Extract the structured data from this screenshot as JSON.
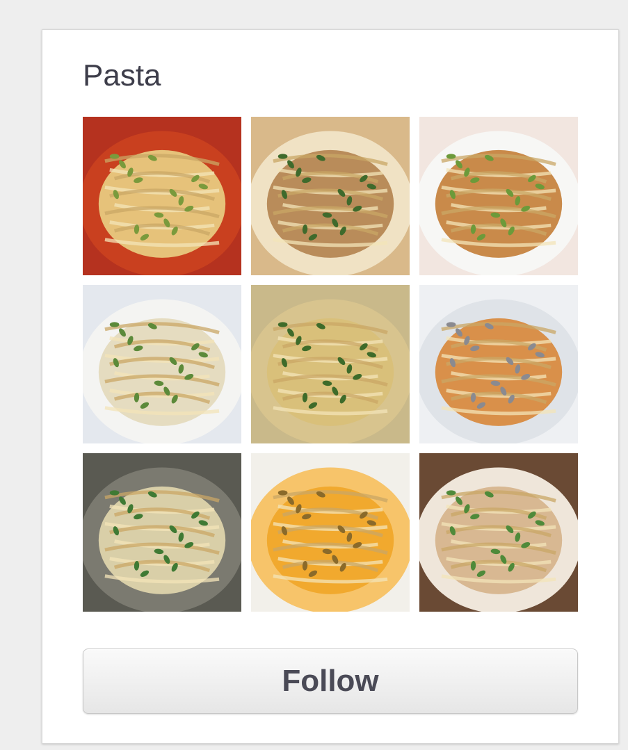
{
  "board": {
    "title": "Pasta",
    "follow_label": "Follow"
  },
  "thumbnails": [
    {
      "name": "thumb-pasta-1",
      "bg": "#b5321f",
      "plate": "#c9401f",
      "food": "#e6c27a",
      "accent": "#7a9a3c"
    },
    {
      "name": "thumb-pasta-2",
      "bg": "#d9b98a",
      "plate": "#f0e2c4",
      "food": "#b98c5a",
      "accent": "#3f6a2c"
    },
    {
      "name": "thumb-pasta-3",
      "bg": "#f2e6e0",
      "plate": "#f7f7f5",
      "food": "#c98a4a",
      "accent": "#6c9a3a"
    },
    {
      "name": "thumb-pasta-4",
      "bg": "#e4e8ee",
      "plate": "#f4f4f2",
      "food": "#e5dcc0",
      "accent": "#5c8a3a"
    },
    {
      "name": "thumb-pasta-5",
      "bg": "#c9b98a",
      "plate": "#d8c48e",
      "food": "#d9c07a",
      "accent": "#3e6b2a"
    },
    {
      "name": "thumb-pasta-6",
      "bg": "#eef0f3",
      "plate": "#dfe3e8",
      "food": "#d9904a",
      "accent": "#8a8a90"
    },
    {
      "name": "thumb-pasta-7",
      "bg": "#5a5a52",
      "plate": "#7b7a70",
      "food": "#d9cfa8",
      "accent": "#3f7a34"
    },
    {
      "name": "thumb-pasta-8",
      "bg": "#f2f0ea",
      "plate": "#f7c46a",
      "food": "#f1a92e",
      "accent": "#8a6a2a"
    },
    {
      "name": "thumb-pasta-9",
      "bg": "#6a4a34",
      "plate": "#efe6da",
      "food": "#d8b892",
      "accent": "#4f8a3a"
    }
  ]
}
